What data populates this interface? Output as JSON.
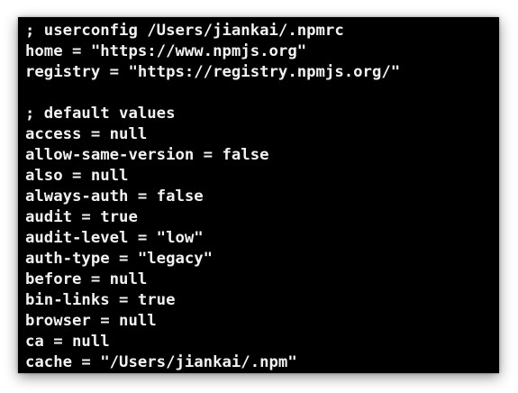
{
  "terminal": {
    "lines": [
      "; userconfig /Users/jiankai/.npmrc",
      "home = \"https://www.npmjs.org\"",
      "registry = \"https://registry.npmjs.org/\"",
      "",
      "; default values",
      "access = null",
      "allow-same-version = false",
      "also = null",
      "always-auth = false",
      "audit = true",
      "audit-level = \"low\"",
      "auth-type = \"legacy\"",
      "before = null",
      "bin-links = true",
      "browser = null",
      "ca = null",
      "cache = \"/Users/jiankai/.npm\""
    ]
  }
}
